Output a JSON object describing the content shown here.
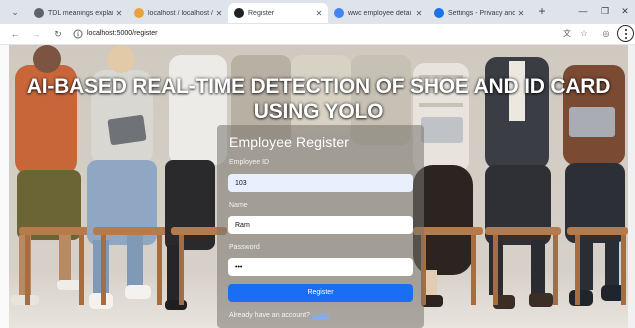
{
  "browser": {
    "tabs": [
      {
        "title": "TDL meanings explained",
        "favicon_color": "#5f6368",
        "active": false
      },
      {
        "title": "localhost / localhost / sho",
        "favicon_color": "#e8a33d",
        "active": false
      },
      {
        "title": "Register",
        "favicon_color": "#202124",
        "active": true
      },
      {
        "title": "wwc employee detai cod",
        "favicon_color": "#4285f4",
        "active": false
      },
      {
        "title": "Settings - Privacy and se",
        "favicon_color": "#1a73e8",
        "active": false
      }
    ],
    "url": "localhost:5000/register"
  },
  "page": {
    "headline": "AI-BASED REAL-TIME DETECTION OF SHOE AND ID CARD USING YOLO",
    "form": {
      "title": "Employee Register",
      "employee_id_label": "Employee ID",
      "employee_id_value": "103",
      "name_label": "Name",
      "name_value": "Ram",
      "password_label": "Password",
      "password_value": "•••",
      "submit_label": "Register",
      "footer_text": "Already have an account?",
      "login_link": "Login"
    }
  },
  "colors": {
    "accent": "#1a6ef5",
    "link": "#7fb0ff"
  }
}
